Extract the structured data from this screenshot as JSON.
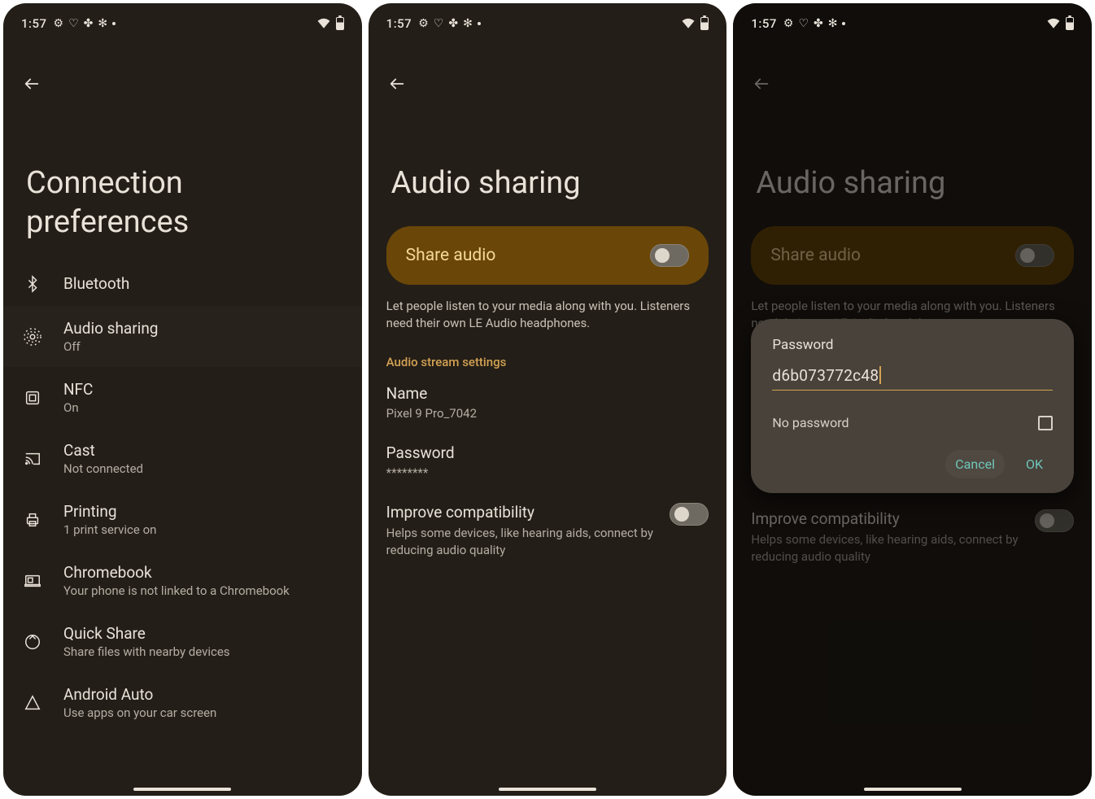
{
  "status": {
    "time": "1:57",
    "icons": [
      "gear-icon",
      "shield-icon",
      "fan-icon",
      "asterisk-icon",
      "dot-icon"
    ],
    "right": [
      "wifi-icon",
      "battery-icon"
    ]
  },
  "screen1": {
    "title": "Connection preferences",
    "items": [
      {
        "icon": "bluetooth",
        "title": "Bluetooth",
        "sub": ""
      },
      {
        "icon": "audio-sharing",
        "title": "Audio sharing",
        "sub": "Off"
      },
      {
        "icon": "nfc",
        "title": "NFC",
        "sub": "On"
      },
      {
        "icon": "cast",
        "title": "Cast",
        "sub": "Not connected"
      },
      {
        "icon": "printing",
        "title": "Printing",
        "sub": "1 print service on"
      },
      {
        "icon": "chromebook",
        "title": "Chromebook",
        "sub": "Your phone is not linked to a Chromebook"
      },
      {
        "icon": "quick-share",
        "title": "Quick Share",
        "sub": "Share files with nearby devices"
      },
      {
        "icon": "android-auto",
        "title": "Android Auto",
        "sub": "Use apps on your car screen"
      }
    ]
  },
  "screen2": {
    "title": "Audio sharing",
    "share_label": "Share audio",
    "desc": "Let people listen to your media along with you. Listeners need their own LE Audio headphones.",
    "section": "Audio stream settings",
    "name_label": "Name",
    "name_value": "Pixel 9 Pro_7042",
    "password_label": "Password",
    "password_value": "********",
    "compat_title": "Improve compatibility",
    "compat_sub": "Helps some devices, like hearing aids, connect by reducing audio quality"
  },
  "screen3": {
    "title": "Audio sharing",
    "share_label": "Share audio",
    "desc": "Let people listen to your media along with you. Listeners need their own LE Audio headphones.",
    "compat_title": "Improve compatibility",
    "compat_sub": "Helps some devices, like hearing aids, connect by reducing audio quality",
    "dialog": {
      "label": "Password",
      "value": "d6b073772c48",
      "no_password": "No password",
      "cancel": "Cancel",
      "ok": "OK"
    }
  }
}
